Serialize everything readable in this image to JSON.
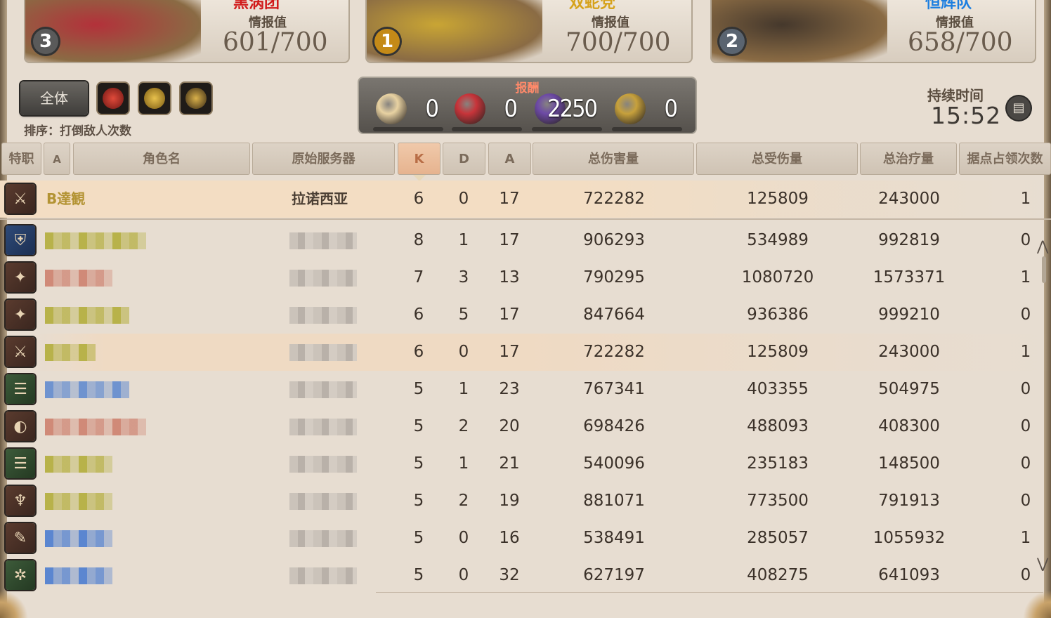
{
  "teams": [
    {
      "name": "黑涡团",
      "name_color": "#d11b1b",
      "intel_label": "情报值",
      "intel": "601/700",
      "rank": "3",
      "rank_color": "#5a5a5a",
      "banner": "#b3313a"
    },
    {
      "name": "双蛇党",
      "name_color": "#d6a21a",
      "intel_label": "情报值",
      "intel": "700/700",
      "rank": "1",
      "rank_color": "#c48a18",
      "banner": "#c9a534"
    },
    {
      "name": "恒辉队",
      "name_color": "#1d7fe0",
      "intel_label": "情报值",
      "intel": "658/700",
      "rank": "2",
      "rank_color": "#5a6470",
      "banner": "#45382c"
    }
  ],
  "filter": {
    "all_label": "全体",
    "sort_label": "排序：打倒敌人次数"
  },
  "reward": {
    "title": "报酬",
    "items": [
      {
        "icon": "wolf-mark-icon",
        "value": "0",
        "color": "#e8d2a2"
      },
      {
        "icon": "red-flower-icon",
        "value": "0",
        "color": "#c8343a"
      },
      {
        "icon": "purple-flower-icon",
        "value": "2250",
        "color": "#6d4aa6"
      },
      {
        "icon": "gold-medal-icon",
        "value": "0",
        "color": "#c7a13c"
      }
    ]
  },
  "duration": {
    "label": "持续时间",
    "value": "15:52"
  },
  "headers": [
    "特职",
    "A",
    "角色名",
    "原始服务器",
    "K",
    "D",
    "A",
    "总伤害量",
    "总受伤量",
    "总治疗量",
    "据点占领次数"
  ],
  "self_row": {
    "job": "melee",
    "job_glyph": "⚔",
    "name": "B達観",
    "server": "拉诺西亚",
    "k": "6",
    "d": "0",
    "a": "17",
    "dmg": "722282",
    "taken": "125809",
    "heal": "243000",
    "cap": "1"
  },
  "rows": [
    {
      "job": "tank",
      "job_glyph": "⛨",
      "tint": "#b8b24a",
      "len": 144,
      "k": "8",
      "d": "1",
      "a": "17",
      "dmg": "906293",
      "taken": "534989",
      "heal": "992819",
      "cap": "0"
    },
    {
      "job": "melee",
      "job_glyph": "✦",
      "tint": "#d08a78",
      "len": 96,
      "k": "7",
      "d": "3",
      "a": "13",
      "dmg": "790295",
      "taken": "1080720",
      "heal": "1573371",
      "cap": "1"
    },
    {
      "job": "melee",
      "job_glyph": "✦",
      "tint": "#b8b24a",
      "len": 120,
      "k": "6",
      "d": "5",
      "a": "17",
      "dmg": "847664",
      "taken": "936386",
      "heal": "999210",
      "cap": "0"
    },
    {
      "job": "melee",
      "job_glyph": "⚔",
      "tint": "#b8b24a",
      "len": 72,
      "k": "6",
      "d": "0",
      "a": "17",
      "dmg": "722282",
      "taken": "125809",
      "heal": "243000",
      "cap": "1",
      "hl": true
    },
    {
      "job": "heal",
      "job_glyph": "☰",
      "tint": "#6f93cf",
      "len": 120,
      "k": "5",
      "d": "1",
      "a": "23",
      "dmg": "767341",
      "taken": "403355",
      "heal": "504975",
      "cap": "0"
    },
    {
      "job": "ranged",
      "job_glyph": "◐",
      "tint": "#d08a78",
      "len": 144,
      "k": "5",
      "d": "2",
      "a": "20",
      "dmg": "698426",
      "taken": "488093",
      "heal": "408300",
      "cap": "0"
    },
    {
      "job": "heal",
      "job_glyph": "☰",
      "tint": "#b8b24a",
      "len": 96,
      "k": "5",
      "d": "1",
      "a": "21",
      "dmg": "540096",
      "taken": "235183",
      "heal": "148500",
      "cap": "0"
    },
    {
      "job": "melee",
      "job_glyph": "♆",
      "tint": "#b8b24a",
      "len": 96,
      "k": "5",
      "d": "2",
      "a": "19",
      "dmg": "881071",
      "taken": "773500",
      "heal": "791913",
      "cap": "0"
    },
    {
      "job": "ranged",
      "job_glyph": "✎",
      "tint": "#5b86d0",
      "len": 96,
      "k": "5",
      "d": "0",
      "a": "16",
      "dmg": "538491",
      "taken": "285057",
      "heal": "1055932",
      "cap": "1"
    },
    {
      "job": "heal",
      "job_glyph": "✲",
      "tint": "#5b86d0",
      "len": 96,
      "k": "5",
      "d": "0",
      "a": "32",
      "dmg": "627197",
      "taken": "408275",
      "heal": "641093",
      "cap": "0"
    }
  ]
}
